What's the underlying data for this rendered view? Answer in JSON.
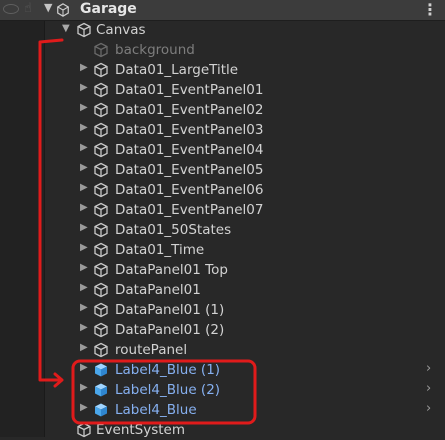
{
  "header": {
    "title": "Garage"
  },
  "canvas": {
    "label": "Canvas"
  },
  "items": [
    {
      "label": "background",
      "dim": true,
      "fold": false,
      "blue": false,
      "chevron": false
    },
    {
      "label": "Data01_LargeTitle",
      "dim": false,
      "fold": true,
      "blue": false,
      "chevron": false
    },
    {
      "label": "Data01_EventPanel01",
      "dim": false,
      "fold": true,
      "blue": false,
      "chevron": false
    },
    {
      "label": "Data01_EventPanel02",
      "dim": false,
      "fold": true,
      "blue": false,
      "chevron": false
    },
    {
      "label": "Data01_EventPanel03",
      "dim": false,
      "fold": true,
      "blue": false,
      "chevron": false
    },
    {
      "label": "Data01_EventPanel04",
      "dim": false,
      "fold": true,
      "blue": false,
      "chevron": false
    },
    {
      "label": "Data01_EventPanel05",
      "dim": false,
      "fold": true,
      "blue": false,
      "chevron": false
    },
    {
      "label": "Data01_EventPanel06",
      "dim": false,
      "fold": true,
      "blue": false,
      "chevron": false
    },
    {
      "label": "Data01_EventPanel07",
      "dim": false,
      "fold": true,
      "blue": false,
      "chevron": false
    },
    {
      "label": "Data01_50States",
      "dim": false,
      "fold": true,
      "blue": false,
      "chevron": false
    },
    {
      "label": "Data01_Time",
      "dim": false,
      "fold": true,
      "blue": false,
      "chevron": false
    },
    {
      "label": "DataPanel01 Top",
      "dim": false,
      "fold": true,
      "blue": false,
      "chevron": false
    },
    {
      "label": "DataPanel01",
      "dim": false,
      "fold": true,
      "blue": false,
      "chevron": false
    },
    {
      "label": "DataPanel01 (1)",
      "dim": false,
      "fold": true,
      "blue": false,
      "chevron": false
    },
    {
      "label": "DataPanel01 (2)",
      "dim": false,
      "fold": true,
      "blue": false,
      "chevron": false
    },
    {
      "label": "routePanel",
      "dim": false,
      "fold": true,
      "blue": false,
      "chevron": false
    },
    {
      "label": "Label4_Blue (1)",
      "dim": false,
      "fold": true,
      "blue": true,
      "chevron": true
    },
    {
      "label": "Label4_Blue (2)",
      "dim": false,
      "fold": true,
      "blue": true,
      "chevron": true
    },
    {
      "label": "Label4_Blue",
      "dim": false,
      "fold": true,
      "blue": true,
      "chevron": true
    }
  ],
  "event_system": {
    "label": "EventSystem"
  },
  "colors": {
    "prefab_blue": "#86b0f0",
    "annotation_red": "#e01b1b"
  }
}
